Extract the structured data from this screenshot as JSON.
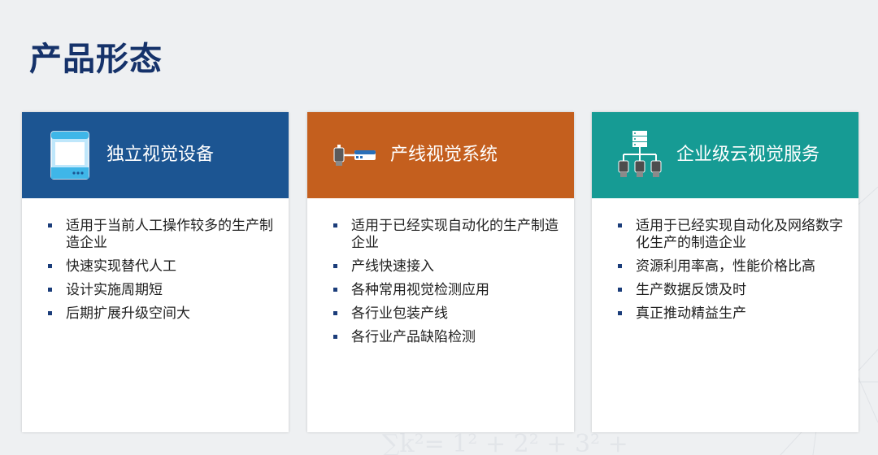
{
  "page": {
    "title": "产品形态"
  },
  "colors": {
    "title": "#15326a",
    "card_blue": "#1c5592",
    "card_orange": "#c45f1e",
    "card_teal": "#169b94",
    "bullet": "#1b3d7a"
  },
  "cards": [
    {
      "title": "独立视觉设备",
      "icon": "vision-device-icon",
      "color": "#1c5592",
      "items": [
        "适用于当前人工操作较多的生产制造企业",
        "快速实现替代人工",
        "设计实施周期短",
        "后期扩展升级空间大"
      ]
    },
    {
      "title": "产线视觉系统",
      "icon": "camera-controller-icon",
      "color": "#c45f1e",
      "items": [
        "适用于已经实现自动化的生产制造企业",
        "产线快速接入",
        "各种常用视觉检测应用",
        "各行业包装产线",
        "各行业产品缺陷检测"
      ]
    },
    {
      "title": "企业级云视觉服务",
      "icon": "server-network-icon",
      "color": "#169b94",
      "items": [
        "适用于已经实现自动化及网络数字化生产的制造企业",
        "资源利用率高，性能价格比高",
        "生产数据反馈及时",
        "真正推动精益生产"
      ]
    }
  ]
}
